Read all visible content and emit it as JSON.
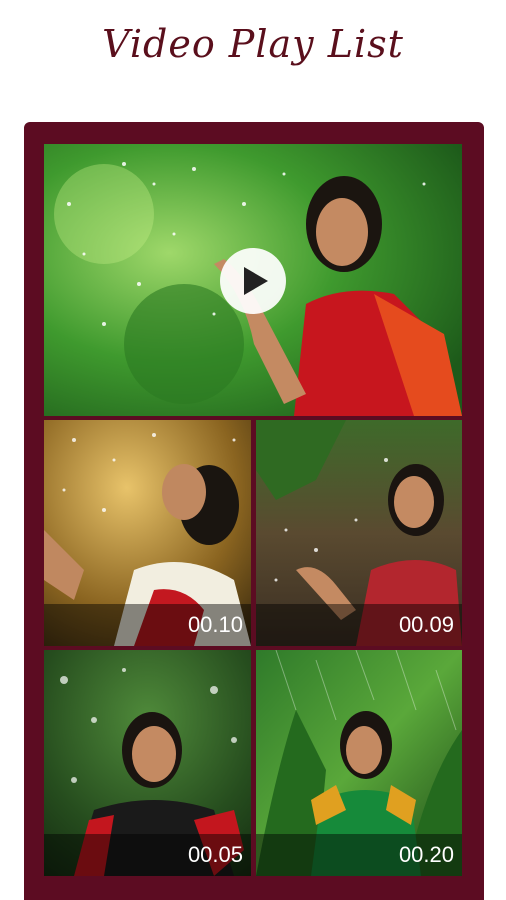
{
  "header": {
    "title": "Video Play List"
  },
  "playlist": {
    "featured": {
      "icon": "play-icon"
    },
    "items": [
      {
        "duration": "00.10"
      },
      {
        "duration": "00.09"
      },
      {
        "duration": "00.05"
      },
      {
        "duration": "00.20"
      }
    ]
  },
  "colors": {
    "accent": "#5c0c22",
    "title": "#5a0f1c"
  }
}
